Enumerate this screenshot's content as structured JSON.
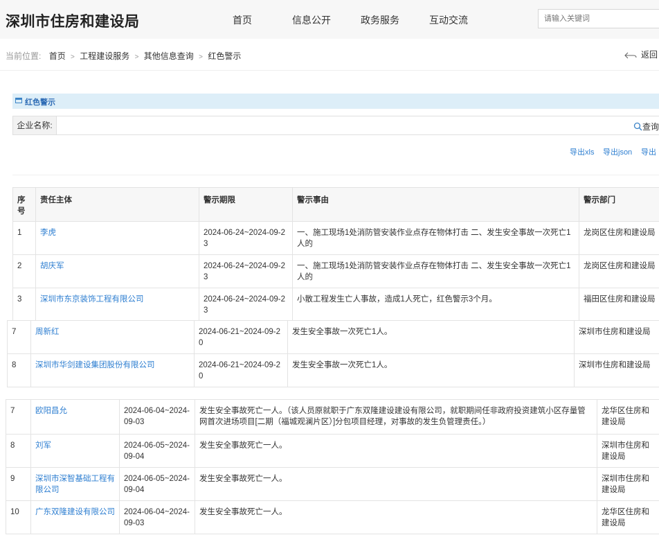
{
  "header": {
    "site_title": "深圳市住房和建设局",
    "nav": [
      "首页",
      "信息公开",
      "政务服务",
      "互动交流"
    ],
    "search_placeholder": "请输入关键词"
  },
  "breadcrumb": {
    "label": "当前位置:",
    "items": [
      "首页",
      "工程建设服务",
      "其他信息查询",
      "红色警示"
    ],
    "separator": ">"
  },
  "back_label": "返回",
  "panel": {
    "title": "红色警示"
  },
  "filter": {
    "label": "企业名称:",
    "query_label": "查询"
  },
  "exports": [
    "导出xls",
    "导出json",
    "导出"
  ],
  "table": {
    "headers": [
      "序号",
      "责任主体",
      "警示期限",
      "警示事由",
      "警示部门"
    ],
    "block1": [
      {
        "no": "1",
        "subject": "李虎",
        "period": "2024-06-24~2024-09-23",
        "reason": "一、施工现场1处消防管安装作业点存在物体打击 二、发生安全事故一次死亡1人的",
        "dept": "龙岗区住房和建设局"
      },
      {
        "no": "2",
        "subject": "胡庆军",
        "period": "2024-06-24~2024-09-23",
        "reason": "一、施工现场1处消防管安装作业点存在物体打击 二、发生安全事故一次死亡1人的",
        "dept": "龙岗区住房和建设局"
      },
      {
        "no": "3",
        "subject": "深圳市东京装饰工程有限公司",
        "period": "2024-06-24~2024-09-23",
        "reason": "小散工程发生亡人事故，造成1人死亡，红色警示3个月。",
        "dept": "福田区住房和建设局"
      }
    ],
    "block2": [
      {
        "no": "7",
        "subject": "周新红",
        "period": "2024-06-21~2024-09-20",
        "reason": "发生安全事故一次死亡1人。",
        "dept": "深圳市住房和建设局"
      },
      {
        "no": "8",
        "subject": "深圳市华剑建设集团股份有限公司",
        "period": "2024-06-21~2024-09-20",
        "reason": "发生安全事故一次死亡1人。",
        "dept": "深圳市住房和建设局"
      }
    ],
    "block3": [
      {
        "no": "7",
        "subject": "欧阳昌允",
        "period": "2024-06-04~2024-09-03",
        "reason": "发生安全事故死亡一人。（该人员原就职于广东双隆建设建设有限公司，就职期间任非政府投资建筑小区存量管网首次进场项目[二期（福城观澜片区）]分包项目经理，对事故的发生负管理责任。）",
        "dept": "龙华区住房和建设局"
      },
      {
        "no": "8",
        "subject": "刘军",
        "period": "2024-06-05~2024-09-04",
        "reason": "发生安全事故死亡一人。",
        "dept": "深圳市住房和建设局"
      },
      {
        "no": "9",
        "subject": "深圳市深智基础工程有限公司",
        "period": "2024-06-05~2024-09-04",
        "reason": "发生安全事故死亡一人。",
        "dept": "深圳市住房和建设局"
      },
      {
        "no": "10",
        "subject": "广东双隆建设有限公司",
        "period": "2024-06-04~2024-09-03",
        "reason": "发生安全事故死亡一人。",
        "dept": "龙华区住房和建设局"
      }
    ]
  }
}
